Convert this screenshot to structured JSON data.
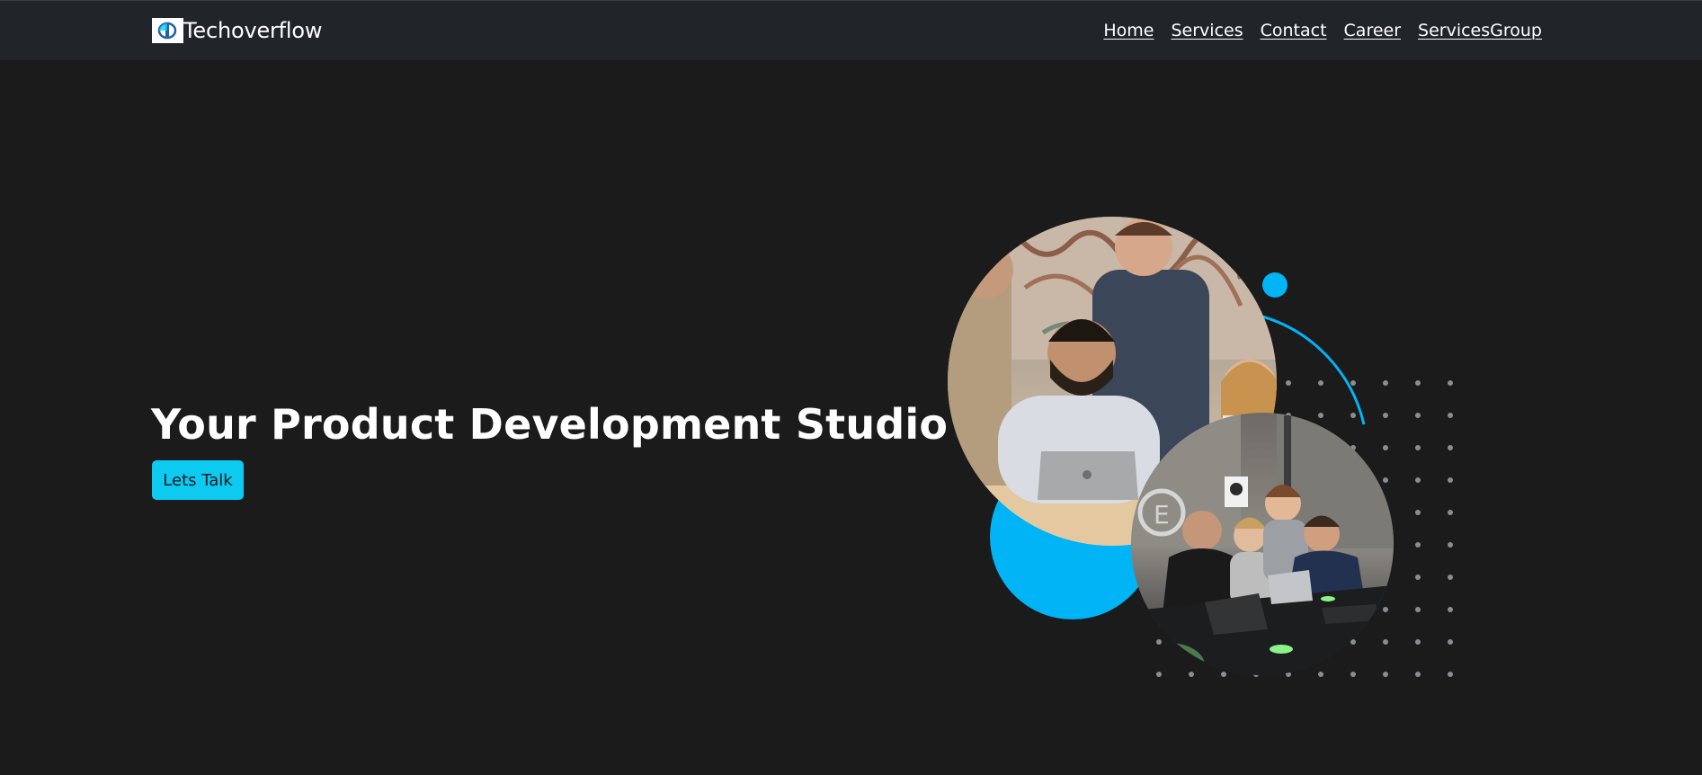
{
  "brand": {
    "name": "Techoverflow",
    "logo_icon": "techoverflow-logo-icon"
  },
  "nav": {
    "items": [
      "Home",
      "Services",
      "Contact",
      "Career",
      "ServicesGroup"
    ]
  },
  "hero": {
    "title": "Your Product Development Studio",
    "cta_label": "Lets Talk"
  },
  "colors": {
    "navbar_bg": "#212529",
    "page_bg": "#1b1b1c",
    "accent": "#0dcaf0",
    "circle_blue": "#00b4f5",
    "dot_gray": "#8a8d91"
  }
}
